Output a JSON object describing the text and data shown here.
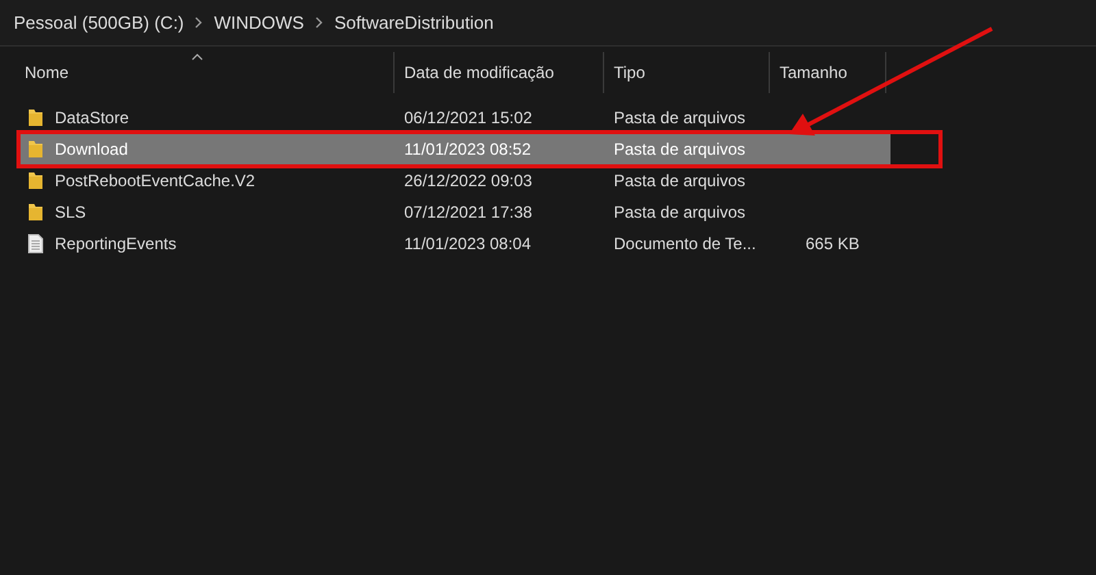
{
  "breadcrumb": [
    "Pessoal (500GB) (C:)",
    "WINDOWS",
    "SoftwareDistribution"
  ],
  "table": {
    "columns": [
      {
        "label": "Nome",
        "sorted": true
      },
      {
        "label": "Data de modificação",
        "sorted": false
      },
      {
        "label": "Tipo",
        "sorted": false
      },
      {
        "label": "Tamanho",
        "sorted": false
      }
    ],
    "rows": [
      {
        "kind": "folder",
        "name": "DataStore",
        "date": "06/12/2021 15:02",
        "type": "Pasta de arquivos",
        "selected": false
      },
      {
        "kind": "folder",
        "name": "Download",
        "date": "11/01/2023 08:52",
        "type": "Pasta de arquivos",
        "selected": true
      },
      {
        "kind": "folder",
        "name": "PostRebootEventCache.V2",
        "date": "26/12/2022 09:03",
        "type": "Pasta de arquivos",
        "selected": false
      },
      {
        "kind": "folder",
        "name": "SLS",
        "date": "07/12/2021 17:38",
        "type": "Pasta de arquivos",
        "selected": false
      },
      {
        "kind": "file",
        "name": "ReportingEvents",
        "date": "11/01/2023 08:04",
        "type": "Documento de Te...",
        "size": "665 KB",
        "selected": false
      }
    ]
  }
}
